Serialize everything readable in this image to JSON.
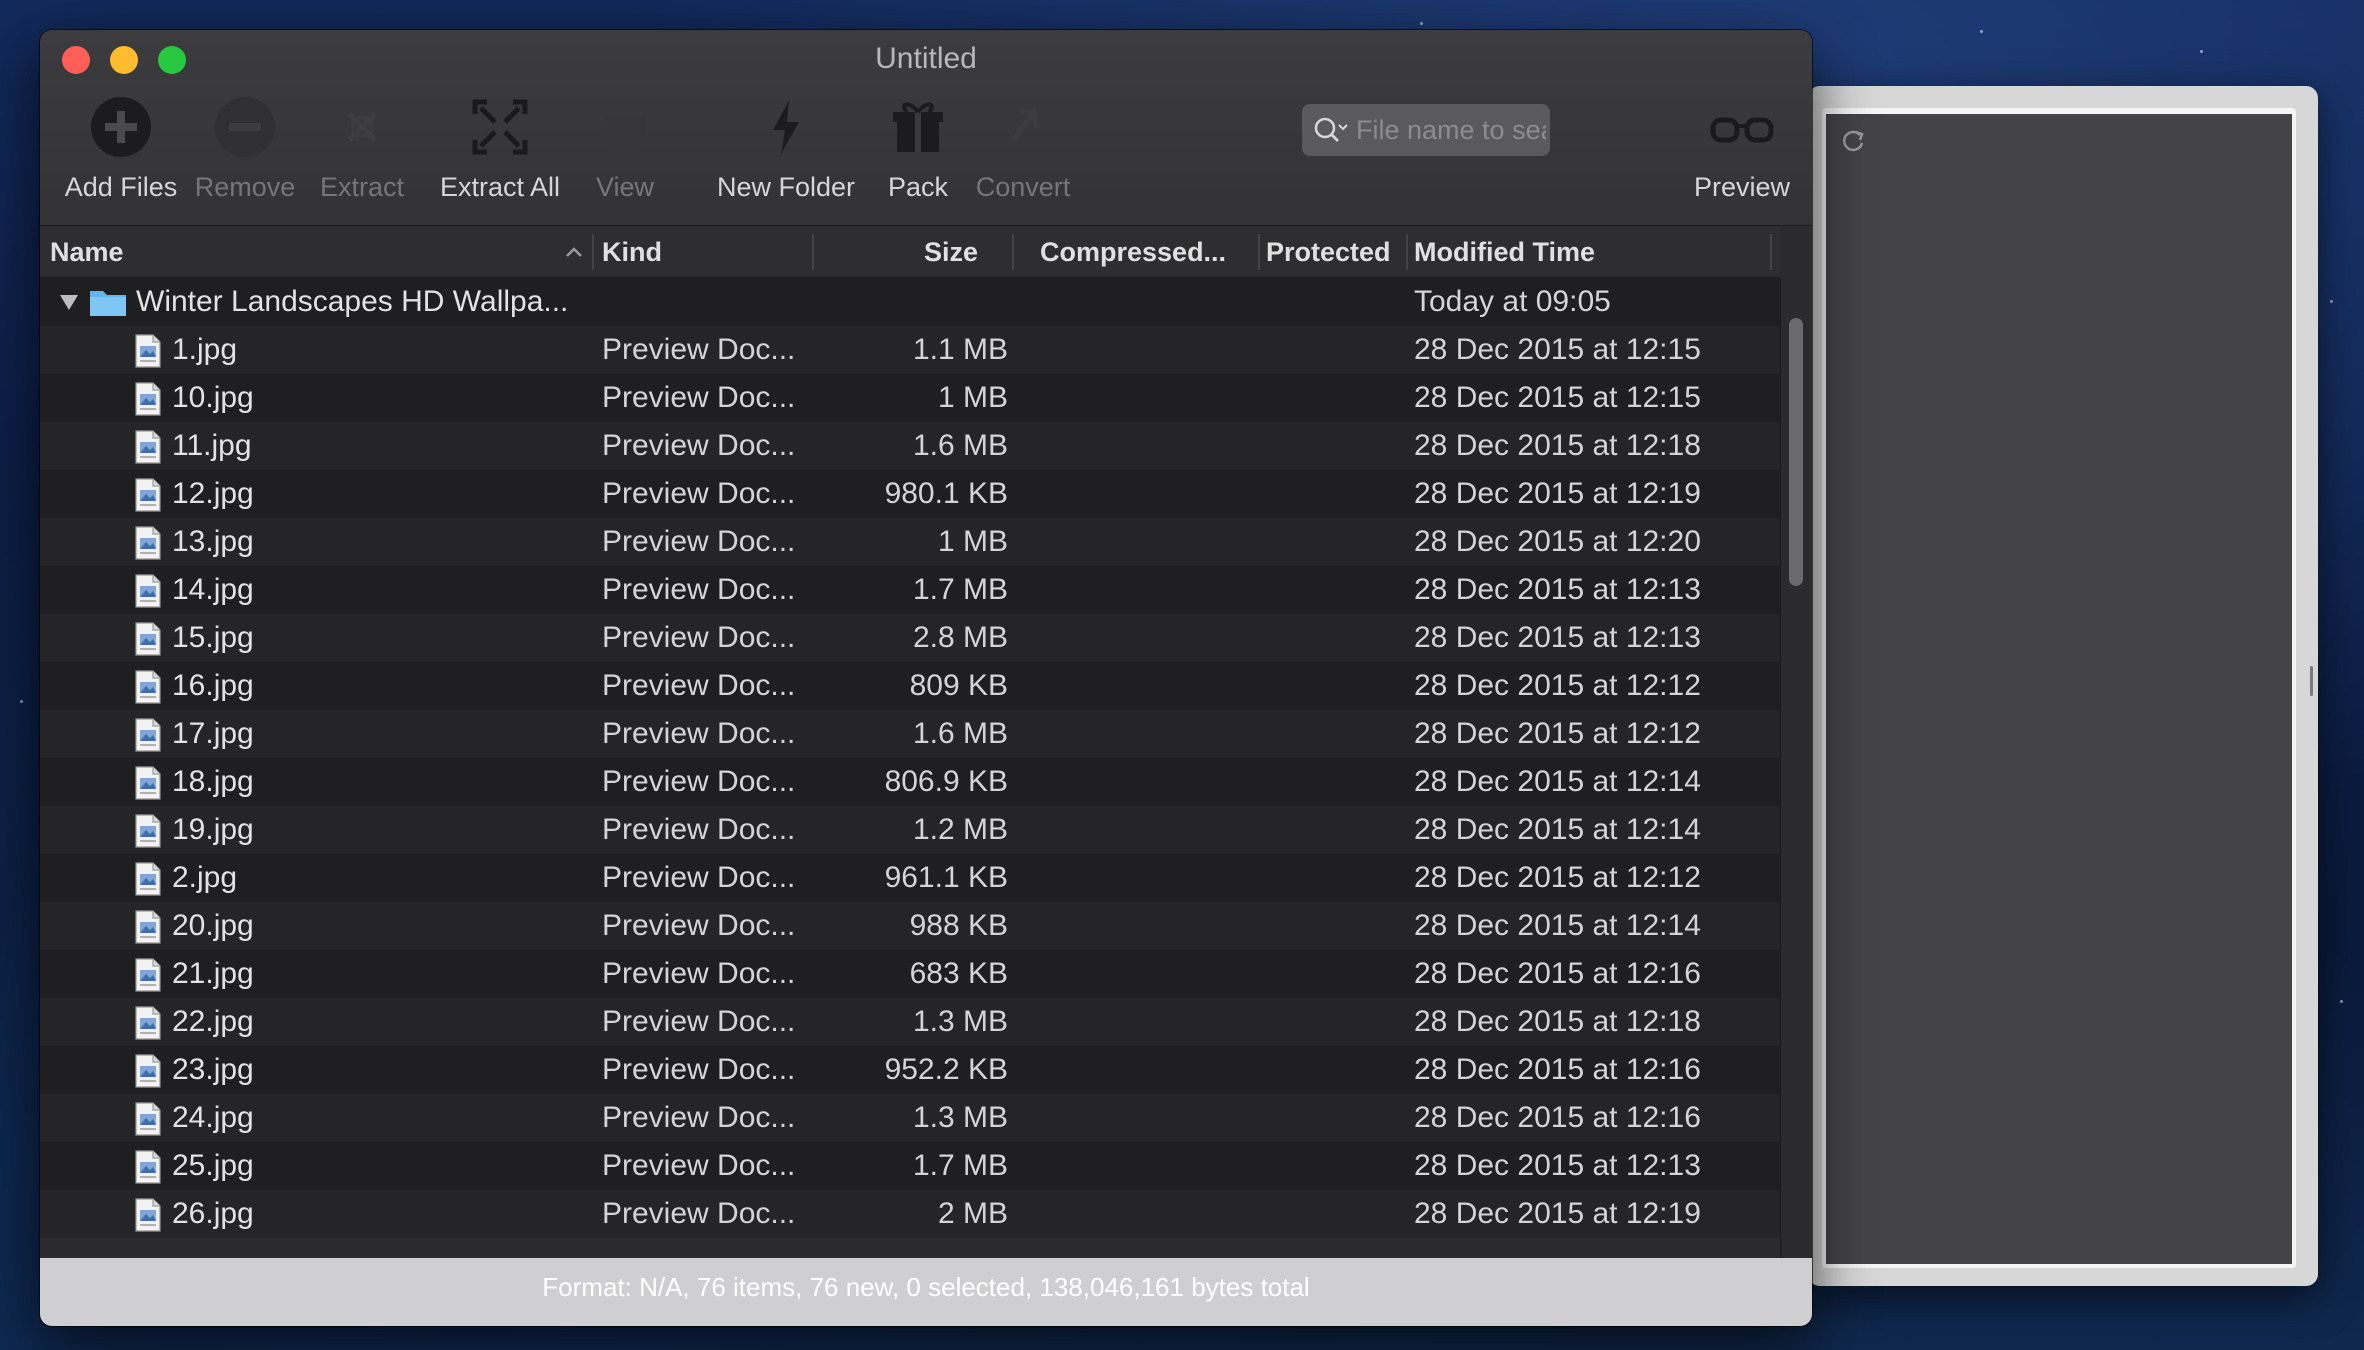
{
  "window": {
    "title": "Untitled"
  },
  "toolbar": {
    "add_files": "Add Files",
    "remove": "Remove",
    "extract": "Extract",
    "extract_all": "Extract All",
    "view": "View",
    "new_folder": "New Folder",
    "pack": "Pack",
    "convert": "Convert",
    "preview": "Preview",
    "search_placeholder": "File name to search"
  },
  "columns": {
    "name": "Name",
    "kind": "Kind",
    "size": "Size",
    "compressed": "Compressed...",
    "protected": "Protected",
    "modified": "Modified Time"
  },
  "folder": {
    "name": "Winter Landscapes HD Wallpa...",
    "modified": "Today at 09:05"
  },
  "files": [
    {
      "name": "1.jpg",
      "kind": "Preview Doc...",
      "size": "1.1 MB",
      "modified": "28 Dec 2015 at 12:15"
    },
    {
      "name": "10.jpg",
      "kind": "Preview Doc...",
      "size": "1 MB",
      "modified": "28 Dec 2015 at 12:15"
    },
    {
      "name": "11.jpg",
      "kind": "Preview Doc...",
      "size": "1.6 MB",
      "modified": "28 Dec 2015 at 12:18"
    },
    {
      "name": "12.jpg",
      "kind": "Preview Doc...",
      "size": "980.1 KB",
      "modified": "28 Dec 2015 at 12:19"
    },
    {
      "name": "13.jpg",
      "kind": "Preview Doc...",
      "size": "1 MB",
      "modified": "28 Dec 2015 at 12:20"
    },
    {
      "name": "14.jpg",
      "kind": "Preview Doc...",
      "size": "1.7 MB",
      "modified": "28 Dec 2015 at 12:13"
    },
    {
      "name": "15.jpg",
      "kind": "Preview Doc...",
      "size": "2.8 MB",
      "modified": "28 Dec 2015 at 12:13"
    },
    {
      "name": "16.jpg",
      "kind": "Preview Doc...",
      "size": "809 KB",
      "modified": "28 Dec 2015 at 12:12"
    },
    {
      "name": "17.jpg",
      "kind": "Preview Doc...",
      "size": "1.6 MB",
      "modified": "28 Dec 2015 at 12:12"
    },
    {
      "name": "18.jpg",
      "kind": "Preview Doc...",
      "size": "806.9 KB",
      "modified": "28 Dec 2015 at 12:14"
    },
    {
      "name": "19.jpg",
      "kind": "Preview Doc...",
      "size": "1.2 MB",
      "modified": "28 Dec 2015 at 12:14"
    },
    {
      "name": "2.jpg",
      "kind": "Preview Doc...",
      "size": "961.1 KB",
      "modified": "28 Dec 2015 at 12:12"
    },
    {
      "name": "20.jpg",
      "kind": "Preview Doc...",
      "size": "988 KB",
      "modified": "28 Dec 2015 at 12:14"
    },
    {
      "name": "21.jpg",
      "kind": "Preview Doc...",
      "size": "683 KB",
      "modified": "28 Dec 2015 at 12:16"
    },
    {
      "name": "22.jpg",
      "kind": "Preview Doc...",
      "size": "1.3 MB",
      "modified": "28 Dec 2015 at 12:18"
    },
    {
      "name": "23.jpg",
      "kind": "Preview Doc...",
      "size": "952.2 KB",
      "modified": "28 Dec 2015 at 12:16"
    },
    {
      "name": "24.jpg",
      "kind": "Preview Doc...",
      "size": "1.3 MB",
      "modified": "28 Dec 2015 at 12:16"
    },
    {
      "name": "25.jpg",
      "kind": "Preview Doc...",
      "size": "1.7 MB",
      "modified": "28 Dec 2015 at 12:13"
    },
    {
      "name": "26.jpg",
      "kind": "Preview Doc...",
      "size": "2 MB",
      "modified": "28 Dec 2015 at 12:19"
    }
  ],
  "status": {
    "text": "Format: N/A, 76 items, 76 new, 0 selected, 138,046,161 bytes total"
  },
  "colors": {
    "close": "#ff5f57",
    "minimize": "#febc2e",
    "maximize": "#28c840",
    "folder": "#5eb7ee"
  }
}
